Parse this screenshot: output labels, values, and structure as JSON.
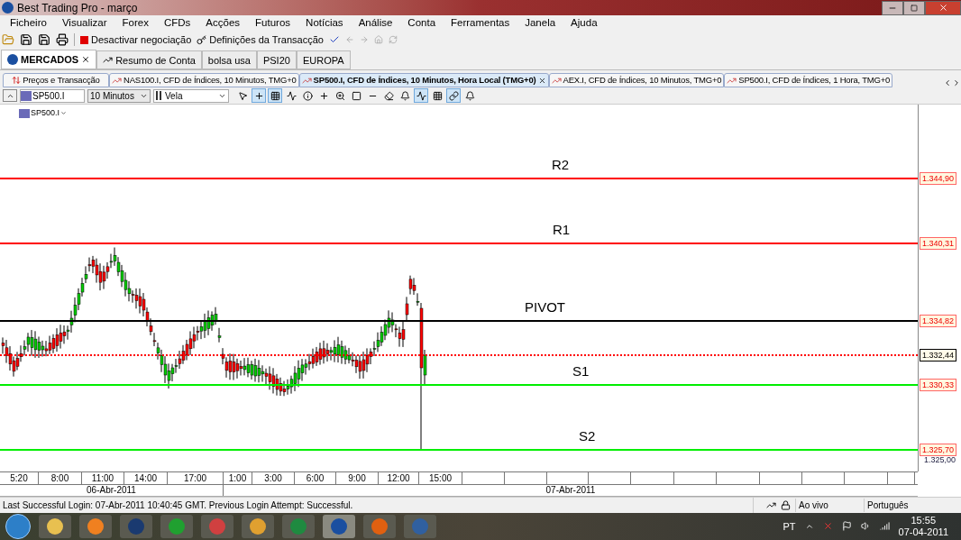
{
  "window": {
    "title": "Best Trading Pro - março"
  },
  "menu": [
    "Ficheiro",
    "Visualizar",
    "Forex",
    "CFDs",
    "Acções",
    "Futuros",
    "Notícias",
    "Análise",
    "Conta",
    "Ferramentas",
    "Janela",
    "Ajuda"
  ],
  "toolbar": {
    "items": [
      {
        "kind": "stop",
        "label": "Desactivar negociação"
      },
      {
        "kind": "settings",
        "label": "Definições da Transacção"
      }
    ]
  },
  "market_tabs": [
    {
      "label": "MERCADOS",
      "selected": true
    },
    {
      "label": "Resumo de Conta",
      "selected": false
    },
    {
      "label": "bolsa usa",
      "selected": false
    },
    {
      "label": "PSI20",
      "selected": false
    },
    {
      "label": "EUROPA",
      "selected": false
    }
  ],
  "chart_tabs": [
    {
      "label": "Preços e Transacção",
      "kind": "prices",
      "selected": false
    },
    {
      "label": "NAS100.I, CFD de Índices, 10 Minutos, TMG+0",
      "kind": "chart",
      "selected": false
    },
    {
      "label": "SP500.I, CFD de Índices, 10 Minutos, Hora Local (TMG+0)",
      "kind": "chart",
      "selected": true
    },
    {
      "label": "AEX.I, CFD de Índices, 10 Minutos, TMG+0",
      "kind": "chart",
      "selected": false
    },
    {
      "label": "SP500.I, CFD de Índices, 1 Hora, TMG+0",
      "kind": "chart",
      "selected": false
    }
  ],
  "chart_toolbar": {
    "symbol": "SP500.I",
    "timeframe": "10 Minutos",
    "chart_type": "Vela",
    "tools": [
      {
        "selected": false
      },
      {
        "selected": true
      },
      {
        "selected": true
      },
      {
        "selected": false
      },
      {
        "selected": false
      },
      {
        "selected": false
      },
      {
        "selected": false
      },
      {
        "selected": false
      },
      {
        "selected": false
      },
      {
        "selected": false
      },
      {
        "selected": false
      },
      {
        "selected": true
      },
      {
        "selected": false
      },
      {
        "selected": true
      },
      {
        "selected": false
      }
    ]
  },
  "chart": {
    "symbol_label": "SP500.I",
    "levels": [
      {
        "label": "R2",
        "price": "1.344,90",
        "color": "#ff0000",
        "kind": "solid"
      },
      {
        "label": "R1",
        "price": "1.340,31",
        "color": "#ff0000",
        "kind": "solid"
      },
      {
        "label": "PIVOT",
        "price": "1.334,82",
        "color": "#000000",
        "kind": "solid"
      },
      {
        "price": "1.332,44",
        "color": "#ff0000",
        "kind": "dotted"
      },
      {
        "label": "S1",
        "price": "1.330,33",
        "color": "#00ee00",
        "kind": "solid"
      },
      {
        "label": "S2",
        "price": "1.325,70",
        "color": "#00ee00",
        "kind": "solid"
      }
    ],
    "axis_tick": "1.325,00",
    "time_labels": [
      "5:20",
      "8:00",
      "11:00",
      "14:00",
      "17:00",
      "1:00",
      "3:00",
      "6:00",
      "9:00",
      "12:00",
      "15:00"
    ],
    "dates": [
      "06-Abr-2011",
      "07-Abr-2011"
    ]
  },
  "status_bar": {
    "message": "Last Successful Login: 07-Abr-2011 10:40:45 GMT. Previous Login Attempt: Successful.",
    "connection": "Ao vivo",
    "language": "Português"
  },
  "taskbar": {
    "language": "PT",
    "time": "15:55",
    "date": "07-04-2011"
  }
}
